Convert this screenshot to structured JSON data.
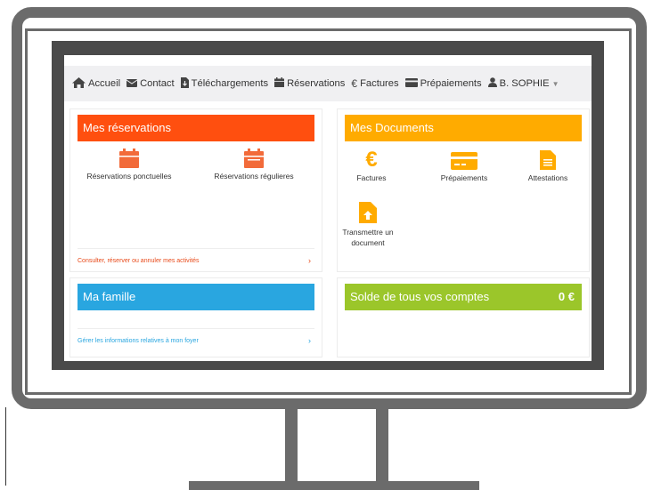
{
  "nav": {
    "items": [
      {
        "label": "Accueil",
        "icon": "home-icon"
      },
      {
        "label": "Contact",
        "icon": "envelope-icon"
      },
      {
        "label": "Téléchargements",
        "icon": "file-download-icon"
      },
      {
        "label": "Réservations",
        "icon": "calendar-icon"
      },
      {
        "label": "Factures",
        "icon": "euro-icon"
      },
      {
        "label": "Prépaiements",
        "icon": "credit-card-icon"
      }
    ],
    "user": {
      "label": "B. SOPHIE",
      "icon": "user-icon"
    }
  },
  "reservations": {
    "title": "Mes réservations",
    "color": "#ff4f0f",
    "tiles": [
      {
        "label": "Réservations ponctuelles",
        "icon": "calendar-icon",
        "color": "#f26b3a"
      },
      {
        "label": "Réservations régulieres",
        "icon": "calendar-icon",
        "color": "#f26b3a"
      }
    ],
    "footer": "Consulter, réserver ou annuler mes activités",
    "footer_color": "#e84a1a"
  },
  "documents": {
    "title": "Mes Documents",
    "color": "#ffab00",
    "tiles": [
      {
        "label": "Factures",
        "icon": "euro-icon"
      },
      {
        "label": "Prépaiements",
        "icon": "credit-card-icon"
      },
      {
        "label": "Attestations",
        "icon": "document-icon"
      },
      {
        "label": "Transmettre un document",
        "icon": "upload-document-icon"
      }
    ]
  },
  "famille": {
    "title": "Ma famille",
    "color": "#29a6e0",
    "footer": "Gérer les informations relatives à mon foyer",
    "footer_color": "#29a6e0"
  },
  "solde": {
    "title": "Solde de tous vos comptes",
    "amount": "0 €",
    "color": "#9bc62a"
  }
}
